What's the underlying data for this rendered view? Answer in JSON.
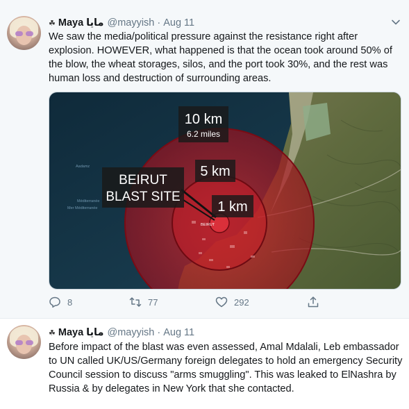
{
  "tweets": [
    {
      "emoji": "☘",
      "name": "Maya",
      "arabic_name": "مايا",
      "handle": "@mayyish",
      "date": "Aug 11",
      "text": "We saw the media/political pressure against the resistance right after explosion. HOWEVER, what happened is that the ocean took around 50% of the blow, the wheat storages, silos, and the port took 30%, and the rest was human loss and destruction of surrounding areas.",
      "media": {
        "labels": {
          "ring_10": "10 km",
          "ring_10_sub": "6.2 miles",
          "ring_5": "5 km",
          "ring_1": "1 km",
          "site_line1": "BEIRUT",
          "site_line2": "BLAST SITE",
          "city": "BEIRUT",
          "sea_1": "Mer Méditerranée",
          "sea_2": "Méditerranée",
          "small_place": "Aadamz"
        }
      },
      "actions": {
        "replies": "8",
        "retweets": "77",
        "likes": "292"
      }
    },
    {
      "emoji": "☘",
      "name": "Maya",
      "arabic_name": "مايا",
      "handle": "@mayyish",
      "date": "Aug 11",
      "text": "Before impact of the blast was even assessed, Amal Mdalali, Leb embassador to UN called UK/US/Germany foreign delegates to hold an emergency Security Council session to discuss \"arms smuggling\". This was leaked to ElNashra by Russia & by delegates in New York that she contacted."
    }
  ],
  "colors": {
    "text": "#14171a",
    "muted": "#657786",
    "highlight_bg": "#f5f8fa",
    "blast_red": "#c0121e"
  },
  "icons": {
    "reply": "reply-icon",
    "retweet": "retweet-icon",
    "like": "heart-icon",
    "share": "share-icon",
    "caret": "chevron-down-icon"
  }
}
